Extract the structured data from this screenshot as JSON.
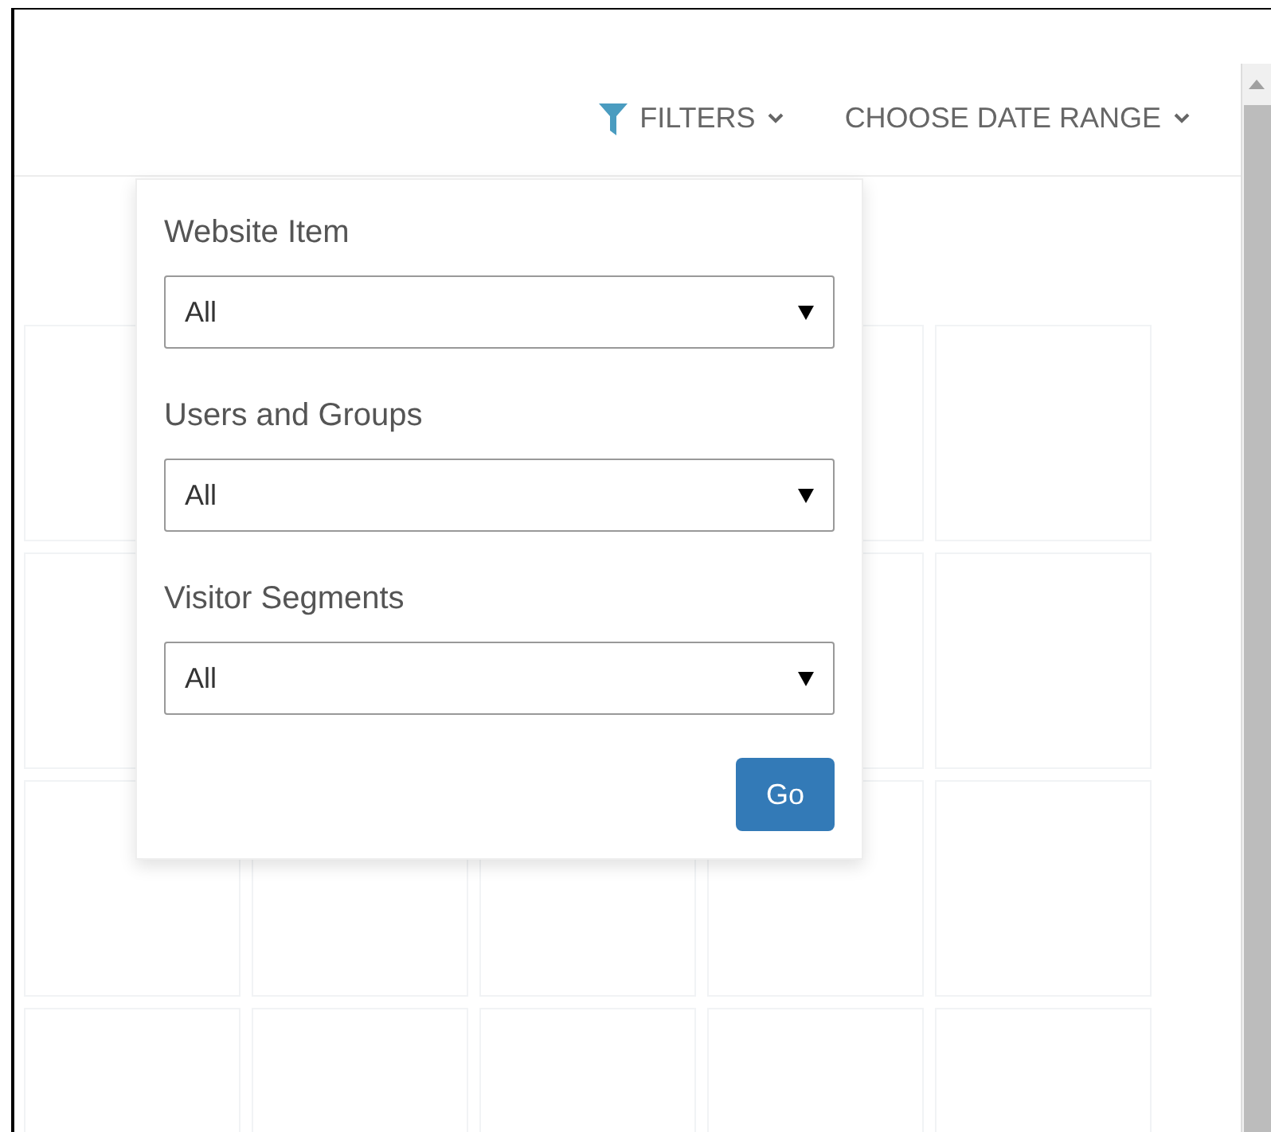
{
  "toolbar": {
    "filters_label": "FILTERS",
    "date_range_label": "CHOOSE DATE RANGE"
  },
  "filter_panel": {
    "fields": [
      {
        "label": "Website Item",
        "value": "All"
      },
      {
        "label": "Users and Groups",
        "value": "All"
      },
      {
        "label": "Visitor Segments",
        "value": "All"
      }
    ],
    "submit": "Go"
  }
}
